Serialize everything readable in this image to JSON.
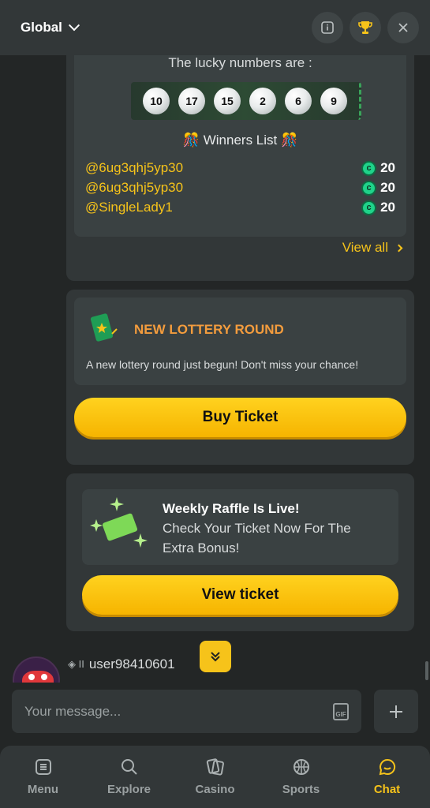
{
  "header": {
    "room": "Global"
  },
  "lottery_result": {
    "title": "The lucky numbers are :",
    "numbers": [
      "10",
      "17",
      "15",
      "2",
      "6",
      "9"
    ],
    "winners_title": "🎊 Winners List 🎊",
    "winners": [
      {
        "name": "@6ug3qhj5yp30",
        "amount": "20"
      },
      {
        "name": "@6ug3qhj5yp30",
        "amount": "20"
      },
      {
        "name": "@SingleLady1",
        "amount": "20"
      }
    ],
    "view_all": "View all"
  },
  "new_round": {
    "title": "NEW LOTTERY ROUND",
    "text": "A new lottery round just begun! Don't miss your chance!",
    "button": "Buy Ticket"
  },
  "raffle": {
    "line1": "Weekly Raffle Is Live!",
    "line2": "Check Your Ticket Now For The",
    "line3": "Extra Bonus!",
    "button": "View ticket"
  },
  "message": {
    "username": "user98410601",
    "level": "II"
  },
  "input": {
    "placeholder": "Your message..."
  },
  "nav": [
    {
      "label": "Menu"
    },
    {
      "label": "Explore"
    },
    {
      "label": "Casino"
    },
    {
      "label": "Sports"
    },
    {
      "label": "Chat"
    }
  ],
  "colors": {
    "accent": "#f6c31a",
    "orange": "#f39c3d",
    "coin": "#1fd38a"
  }
}
